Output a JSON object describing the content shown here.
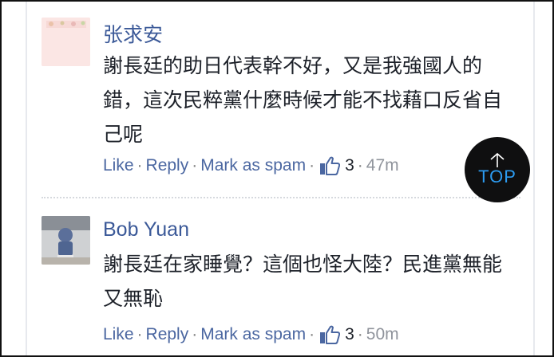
{
  "comments": [
    {
      "author": "张求安",
      "text": "謝長廷的助日代表幹不好，又是我強國人的錯，這次民粹黨什麼時候才能不找藉口反省自己呢",
      "actions": {
        "like": "Like",
        "reply": "Reply",
        "spam": "Mark as spam",
        "likes": "3",
        "time": "47m"
      }
    },
    {
      "author": "Bob Yuan",
      "text": "謝長廷在家睡覺？這個也怪大陸？民進黨無能又無恥",
      "actions": {
        "like": "Like",
        "reply": "Reply",
        "spam": "Mark as spam",
        "likes": "3",
        "time": "50m"
      }
    }
  ],
  "top_button": {
    "label": "TOP"
  },
  "icons": {
    "like": "thumbs-up-icon",
    "scroll_top": "arrow-up-icon"
  },
  "colors": {
    "link": "#4b67a1",
    "author": "#3b5998",
    "text": "#1d2129",
    "top_text": "#2c9bf0"
  }
}
